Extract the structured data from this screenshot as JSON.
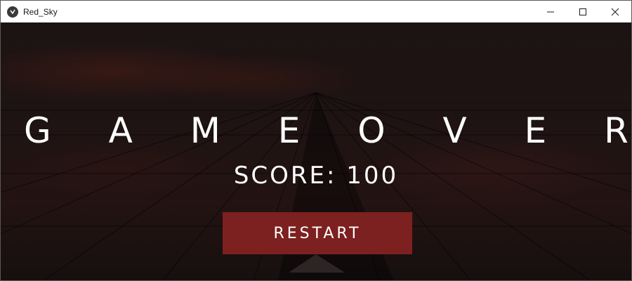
{
  "window": {
    "title": "Red_Sky",
    "controls": [
      "minimize",
      "maximize",
      "close"
    ]
  },
  "game": {
    "title": "G A M E   O V E R",
    "score_text": "SCORE: 100",
    "restart_label": "RESTART"
  },
  "colors": {
    "button": "#7d2020",
    "text": "#ffffff",
    "background": "#1a1212"
  }
}
